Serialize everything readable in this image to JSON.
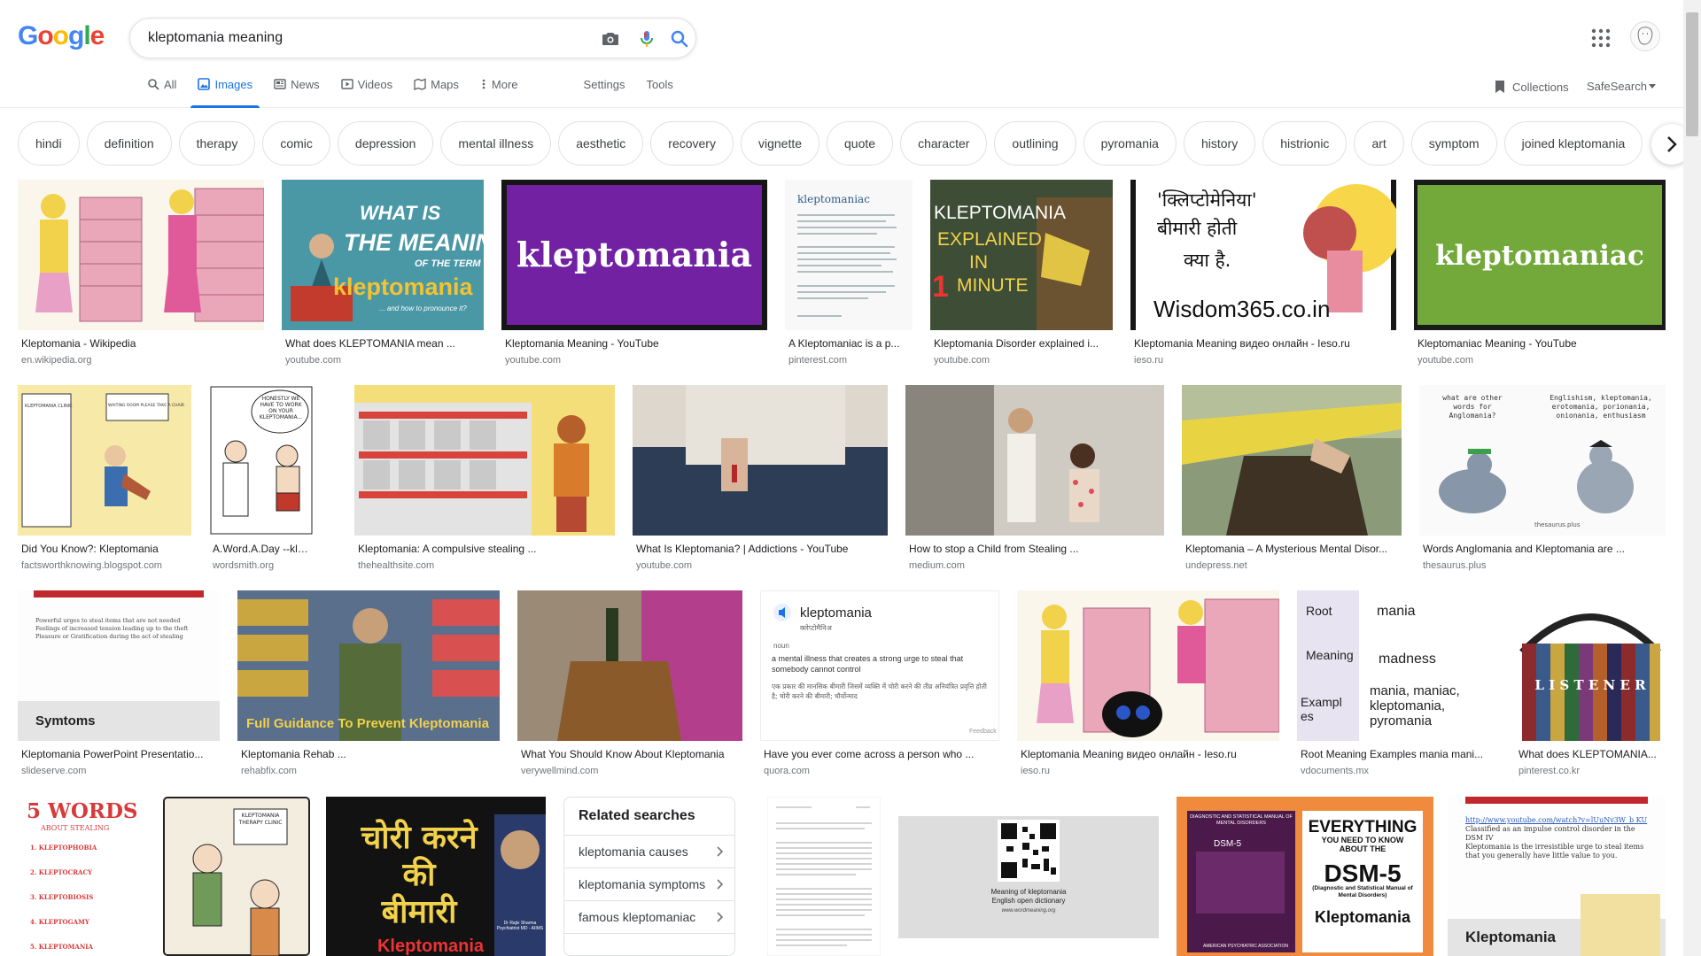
{
  "logo": {
    "g1": "G",
    "o1": "o",
    "o2": "o",
    "g2": "g",
    "l": "l",
    "e": "e"
  },
  "search": {
    "query": "kleptomania meaning"
  },
  "tabs": {
    "all": "All",
    "images": "Images",
    "news": "News",
    "videos": "Videos",
    "maps": "Maps",
    "more": "More",
    "settings": "Settings",
    "tools": "Tools"
  },
  "header_right": {
    "collections": "Collections",
    "safesearch": "SafeSearch"
  },
  "chips": [
    "hindi",
    "definition",
    "therapy",
    "comic",
    "depression",
    "mental illness",
    "aesthetic",
    "recovery",
    "vignette",
    "quote",
    "character",
    "outlining",
    "pyromania",
    "history",
    "histrionic",
    "art",
    "symptom",
    "joined kleptomania"
  ],
  "results": [
    {
      "title": "Kleptomania - Wikipedia",
      "source": "en.wikipedia.org"
    },
    {
      "title": "What does KLEPTOMANIA mean ...",
      "source": "youtube.com",
      "text1": "WHAT IS",
      "text2": "THE MEANING",
      "text3": "OF THE TERM",
      "text4": "kleptomania",
      "text5": "... and how to pronounce it?"
    },
    {
      "title": "Kleptomania Meaning - YouTube",
      "source": "youtube.com",
      "text1": "kleptomania"
    },
    {
      "title": "A Kleptomaniac is a p...",
      "source": "pinterest.com",
      "text1": "kleptomaniac"
    },
    {
      "title": "Kleptomania Disorder explained i...",
      "source": "youtube.com",
      "text1": "KLEPTOMANIA",
      "text2": "EXPLAINED",
      "text3": "IN",
      "text4": "1",
      "text5": "MINUTE"
    },
    {
      "title": "Kleptomania Meaning видео онлайн - Ieso.ru",
      "source": "ieso.ru",
      "text1": "'क्लिप्टोमेनिया'",
      "text2": "बीमारी होती",
      "text3": "क्या है.",
      "text4": "Wisdom365.co.in"
    },
    {
      "title": "Kleptomaniac Meaning - YouTube",
      "source": "youtube.com",
      "text1": "kleptomaniac"
    },
    {
      "title": "Did You Know?: Kleptomania",
      "source": "factsworthknowing.blogspot.com",
      "text1": "KLEPTOMANIA CLINIC",
      "text2": "WAITING ROOM PLEASE TAKE A CHAIR"
    },
    {
      "title": "A.Word.A.Day --klepto...",
      "source": "wordsmith.org",
      "text1": "HONESTLY WE HAVE TO WORK ON YOUR KLEPTOMANIA..."
    },
    {
      "title": "Kleptomania: A compulsive stealing ...",
      "source": "thehealthsite.com"
    },
    {
      "title": "What Is Kleptomania? | Addictions - YouTube",
      "source": "youtube.com"
    },
    {
      "title": "How to stop a Child from Stealing ...",
      "source": "medium.com"
    },
    {
      "title": "Kleptomania – A Mysterious Mental Disor...",
      "source": "undepress.net"
    },
    {
      "title": "Words Anglomania and Kleptomania are ...",
      "source": "thesaurus.plus",
      "text1": "what are other words for Anglomania?",
      "text2": "Englishism, kleptomania, erotomania, porionania, onionania, enthusiasm",
      "text3": "thesaurus.plus"
    },
    {
      "title": "Kleptomania PowerPoint Presentatio...",
      "source": "slideserve.com",
      "text1": "Powerful urges to steal items that are not needed",
      "text2": "Feelings of increased tension leading up to the theft",
      "text3": "Pleasure or Gratification during the act of stealing",
      "text4": "Symtoms"
    },
    {
      "title": "Kleptomania Rehab ...",
      "source": "rehabfix.com",
      "text1": "Full Guidance To Prevent Kleptomania"
    },
    {
      "title": "What You Should Know About Kleptomania",
      "source": "verywellmind.com"
    },
    {
      "title": "Have you ever come across a person who ...",
      "source": "quora.com",
      "text1": "kleptomania",
      "text2": "क्लेप्टोमैनिअ",
      "text3": "noun",
      "text4": "a mental illness that creates a strong urge to steal that somebody cannot control",
      "text5": "एक प्रकार की मानसिक बीमारी जिसमें व्यक्ति में चोरी करने की तीव्र अनियंत्रित प्रवृत्ति होती है; चोरी करने की बीमारी; चौर्योन्माद",
      "text6": "Feedback"
    },
    {
      "title": "Kleptomania Meaning видео онлайн - Ieso.ru",
      "source": "ieso.ru"
    },
    {
      "title": "Root Meaning Examples mania mani...",
      "source": "vdocuments.mx",
      "text1": "Root",
      "text2": "mania",
      "text3": "Meaning",
      "text4": "madness",
      "text5": "Exampl es",
      "text6": "mania, maniac, kleptomania, pyromania"
    },
    {
      "title": "What does KLEPTOMANIA...",
      "source": "pinterest.co.kr",
      "text1": "L I S T E N E R"
    }
  ],
  "bottom": {
    "words_title": "5 WORDS",
    "words_sub": "ABOUT STEALING",
    "words_items": [
      "1. KLEPTOPHOBIA",
      "2. KLEPTOCRACY",
      "3. KLEPTOBIOSIS",
      "4. KLEPTOGAMY",
      "5. KLEPTOMANIA"
    ],
    "cartoon": "KLEPTOMANIA THERAPY CLINIC",
    "hindi1": "चोरी करने",
    "hindi2": "की",
    "hindi3": "बीमारी",
    "hindi4": "Kleptomania",
    "hindi5": "Dr Rajiv Sharma Psychiatrist MD - AIIMS",
    "qr1": "Meaning of kleptomania",
    "qr2": "English open dictionary",
    "qr3": "www.wordmeaning.org",
    "dsm1": "DIAGNOSTIC AND STATISTICAL MANUAL OF MENTAL DISORDERS",
    "dsm2": "DSM-5",
    "dsm3": "EVERYTHING",
    "dsm4": "YOU NEED TO KNOW ABOUT THE",
    "dsm5": "DSM-5",
    "dsm6": "(Diagnostic and Statistical Manual of Mental Disorders)",
    "dsm7": "Kleptomania",
    "dsm8": "AMERICAN PSYCHIATRIC ASSOCIATION",
    "yt1": "http://www.youtube.com/watch?v=lUuNv3W_b KU",
    "yt2": "Classified as an impulse control disorder in the DSM IV",
    "yt3": "Kleptomania is the irresistible urge to steal items that you generally have little value to you.",
    "yt4": "Kleptomania"
  },
  "related": {
    "title": "Related searches",
    "items": [
      "kleptomania causes",
      "kleptomania symptoms",
      "famous kleptomaniac"
    ]
  },
  "colors": {
    "blue": "#4285f4",
    "red": "#ea4335",
    "yellow": "#fbbc05",
    "green": "#34a853",
    "accent": "#1a73e8"
  }
}
